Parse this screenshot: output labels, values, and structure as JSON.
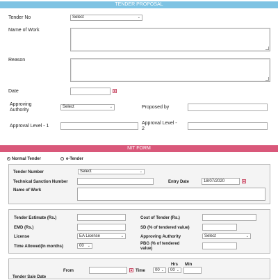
{
  "colors": {
    "header_top": "#7ec3e3",
    "header_nit": "#d9587a",
    "cal_accent": "#c9516a"
  },
  "tender_proposal": {
    "title": "TENDER PROPOSAL",
    "tender_no_label": "Tender No",
    "tender_no_value": "Select",
    "name_of_work_label": "Name of Work",
    "reason_label": "Reason",
    "date_label": "Date",
    "approving_authority_label_1": "Approving",
    "approving_authority_label_2": "Authority",
    "approving_authority_value": "Select",
    "proposed_by_label": "Proposed by",
    "approval_level_1_label": "Approval Level - 1",
    "approval_level_2_label_1": "Approval  Level  -",
    "approval_level_2_label_2": "2"
  },
  "nit_form": {
    "title": "NIT FORM",
    "radio_normal": "Normal Tender",
    "radio_etender": "e-Tender",
    "tender_number_label": "Tender Number",
    "tender_number_value": "Select",
    "tech_sanction_label": "Technical Sanction Number",
    "entry_date_label": "Entry Date",
    "entry_date_value": "18/07/2020",
    "name_of_work_label": "Name of Work",
    "tender_estimate_label": "Tender Estimate (Rs.)",
    "cost_of_tender_label": "Cost of Tender (Rs.)",
    "emd_label": "EMD (Rs.)",
    "sd_label": "SD (% of tendered value)",
    "license_label": "License",
    "license_value": "EA License",
    "approving_authority_label": "Approving Authority",
    "approving_authority_value": "Select",
    "time_allowed_label": "Time Allowed(In months)",
    "time_allowed_value": "00",
    "pbg_label_1": "PBG    (%    of    tendered",
    "pbg_label_2": "value)",
    "from_label": "From",
    "time_label": "Time",
    "hrs_label": "Hrs",
    "min_label": "Min",
    "hrs_value": "00",
    "min_value": "00",
    "tender_sale_date_label": "Tender Sale Date"
  }
}
